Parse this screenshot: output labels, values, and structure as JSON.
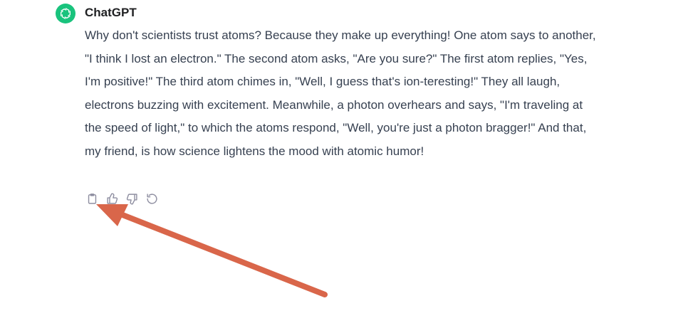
{
  "message": {
    "author": "ChatGPT",
    "avatar_icon": "openai-logo-icon",
    "avatar_color": "#19c37d",
    "text": "Why don't scientists trust atoms? Because they make up everything! One atom says to another, \"I think I lost an electron.\" The second atom asks, \"Are you sure?\" The first atom replies, \"Yes, I'm positive!\" The third atom chimes in, \"Well, I guess that's ion-teresting!\" They all laugh, electrons buzzing with excitement. Meanwhile, a photon overhears and says, \"I'm traveling at the speed of light,\" to which the atoms respond, \"Well, you're just a photon bragger!\" And that, my friend, is how science lightens the mood with atomic humor!"
  },
  "actions": [
    {
      "icon": "copy-clipboard-icon"
    },
    {
      "icon": "thumbs-up-icon"
    },
    {
      "icon": "thumbs-down-icon"
    },
    {
      "icon": "regenerate-icon"
    }
  ],
  "annotation": {
    "icon": "arrow-pointer-icon",
    "color": "#d9664a"
  }
}
